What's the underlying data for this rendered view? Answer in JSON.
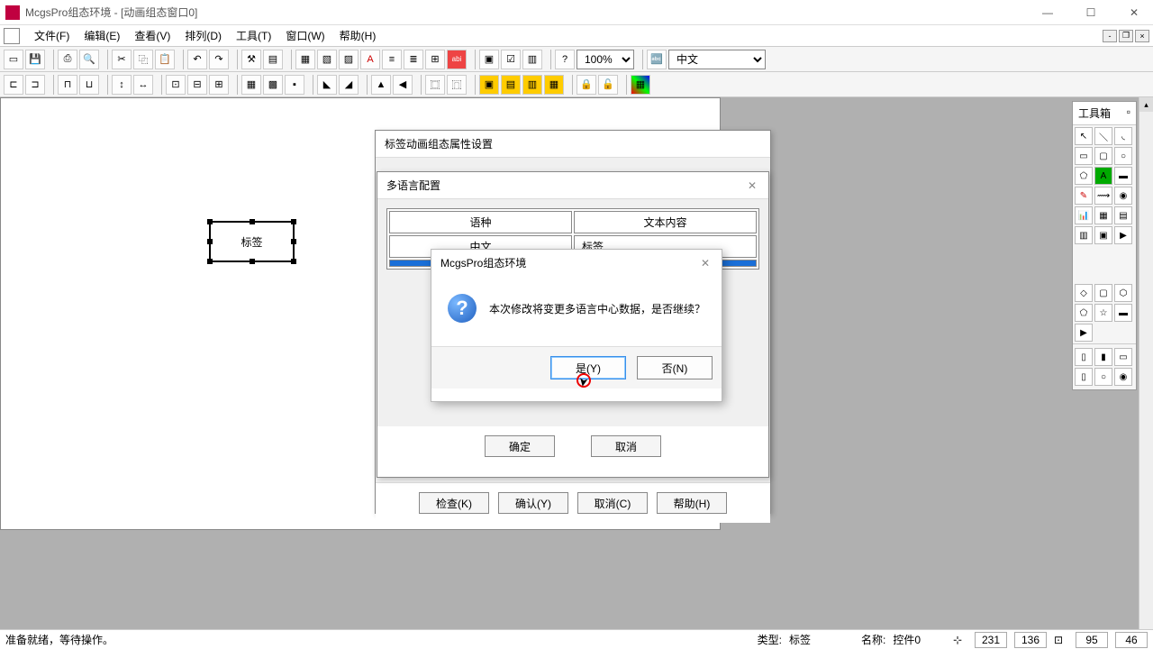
{
  "titlebar": {
    "title": "McgsPro组态环境 - [动画组态窗口0]"
  },
  "menu": {
    "file": "文件(F)",
    "edit": "编辑(E)",
    "view": "查看(V)",
    "arrange": "排列(D)",
    "tools": "工具(T)",
    "window": "窗口(W)",
    "help": "帮助(H)"
  },
  "toolbar": {
    "zoom": "100%",
    "language": "中文"
  },
  "toolbox": {
    "title": "工具箱"
  },
  "widget": {
    "label": "标签"
  },
  "dialog_prop": {
    "title": "标签动画组态属性设置",
    "btn_check": "检查(K)",
    "btn_confirm": "确认(Y)",
    "btn_cancel": "取消(C)",
    "btn_help": "帮助(H)"
  },
  "dialog_lang": {
    "title": "多语言配置",
    "col_lang": "语种",
    "col_text": "文本内容",
    "row1_lang": "中文",
    "row1_text": "标签",
    "row2_lang": "",
    "row2_text": "",
    "btn_ok": "确定",
    "btn_cancel": "取消"
  },
  "dialog_confirm": {
    "title": "McgsPro组态环境",
    "message": "本次修改将变更多语言中心数据，是否继续？",
    "btn_yes": "是(Y)",
    "btn_no": "否(N)"
  },
  "statusbar": {
    "ready": "准备就绪，等待操作。",
    "type_label": "类型:",
    "type_value": "标签",
    "name_label": "名称:",
    "name_value": "控件0",
    "x": "231",
    "y": "136",
    "w": "95",
    "h": "46"
  }
}
